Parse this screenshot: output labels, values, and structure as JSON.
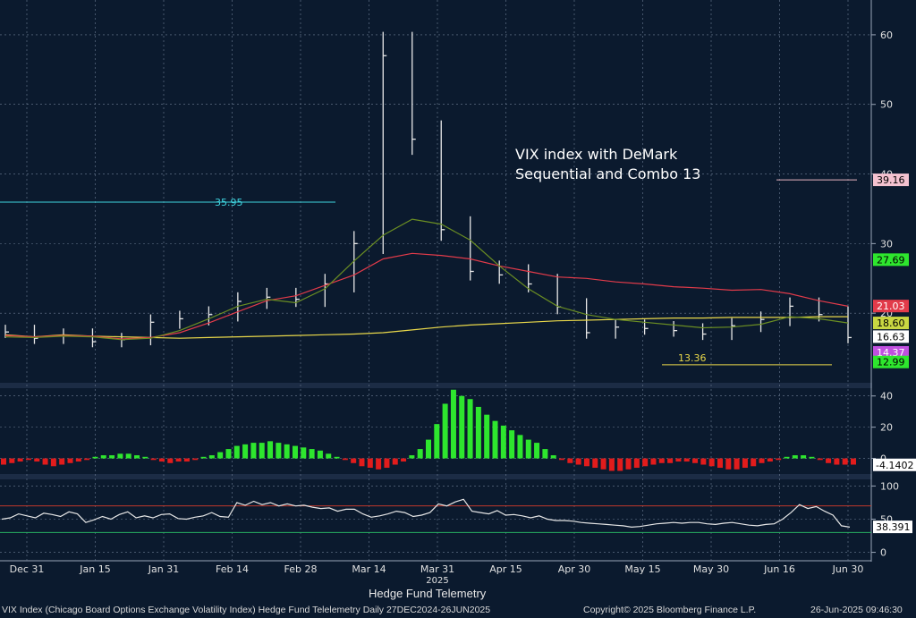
{
  "chart_data": [
    {
      "type": "bar",
      "panel": "price",
      "title": "VIX index with DeMark\nSequential and Combo 13",
      "ylim": [
        10,
        65
      ],
      "yticks": [
        20,
        30,
        40,
        50,
        60
      ],
      "grid": true,
      "x": [
        "Dec 31",
        "Jan 15",
        "Jan 31",
        "Feb 14",
        "Feb 28",
        "Mar 14",
        "Mar 31",
        "Apr 15",
        "Apr 30",
        "May 15",
        "May 30",
        "Jun 16",
        "Jun 30"
      ],
      "series": [
        {
          "values": [
            17.3,
            16.4,
            16.8,
            15.9,
            16.2,
            18.7,
            19.2,
            19.8,
            21.7,
            22.3,
            22.0,
            24.2,
            30.0,
            57.0,
            45.0,
            32.0,
            26.0,
            25.5,
            24.2,
            20.9,
            17.2,
            18.0,
            17.8,
            17.5,
            17.0,
            18.2,
            19.1,
            21.0,
            19.8,
            16.5
          ]
        },
        {
          "values": [
            16.9,
            16.6,
            16.9,
            16.7,
            16.6,
            16.5,
            16.4,
            16.5,
            16.6,
            16.7,
            16.8,
            16.9,
            17.0,
            17.2,
            17.6,
            18.0,
            18.3,
            18.5,
            18.7,
            18.9,
            19.0,
            19.1,
            19.2,
            19.3,
            19.3,
            19.4,
            19.4,
            19.4,
            19.5,
            19.5
          ]
        },
        {
          "values": [
            16.8,
            16.6,
            16.8,
            16.7,
            16.3,
            16.5,
            17.2,
            18.6,
            20.2,
            21.8,
            22.5,
            24.0,
            25.5,
            27.8,
            28.6,
            28.3,
            27.8,
            26.8,
            26.0,
            25.2,
            25.0,
            24.5,
            24.2,
            23.8,
            23.6,
            23.3,
            23.4,
            22.8,
            21.8,
            21.0
          ]
        },
        {
          "values": [
            16.6,
            16.5,
            16.7,
            16.6,
            16.2,
            16.4,
            17.5,
            19.2,
            21.0,
            22.0,
            21.5,
            23.5,
            27.5,
            31.2,
            33.5,
            32.8,
            30.5,
            26.8,
            23.5,
            21.0,
            19.8,
            19.1,
            18.7,
            18.3,
            17.9,
            18.0,
            18.4,
            19.5,
            19.2,
            18.6
          ]
        }
      ],
      "last_values": {
        "price_high": "39.16",
        "c1": "27.69",
        "c2": "21.03",
        "c3": "18.60",
        "close": "16.63",
        "c5": "14.37",
        "c6": "12.99"
      },
      "annotations": {
        "left_level": "35.95",
        "may_low": "13.36"
      }
    },
    {
      "type": "bar",
      "panel": "oscillator",
      "ylim": [
        -10,
        45
      ],
      "yticks": [
        0,
        20,
        40
      ],
      "grid": true,
      "last_value": "-4.1402",
      "values": [
        -4,
        -3,
        -2,
        -1,
        -2,
        -4,
        -5,
        -4,
        -3,
        -2,
        -1,
        1,
        2,
        2,
        3,
        3,
        2,
        1,
        -1,
        -2,
        -3,
        -2,
        -2,
        -1,
        1,
        2,
        4,
        6,
        8,
        9,
        10,
        10,
        11,
        10,
        9,
        8,
        7,
        6,
        5,
        3,
        1,
        -1,
        -3,
        -5,
        -6,
        -7,
        -6,
        -4,
        -2,
        2,
        6,
        12,
        22,
        35,
        44,
        40,
        38,
        33,
        28,
        24,
        21,
        18,
        15,
        12,
        10,
        6,
        2,
        -1,
        -3,
        -4,
        -5,
        -6,
        -7,
        -8,
        -8,
        -7,
        -6,
        -5,
        -4,
        -3,
        -3,
        -2,
        -2,
        -3,
        -4,
        -5,
        -6,
        -7,
        -7,
        -6,
        -5,
        -3,
        -2,
        -1,
        1,
        2,
        2,
        1,
        -1,
        -3,
        -4,
        -4,
        -4
      ]
    },
    {
      "type": "line",
      "panel": "breadth",
      "ylim": [
        -10,
        110
      ],
      "yticks": [
        0,
        50,
        100
      ],
      "grid": true,
      "last_value": "38.391",
      "values": [
        50,
        52,
        58,
        55,
        52,
        59,
        57,
        54,
        61,
        58,
        45,
        49,
        54,
        50,
        57,
        61,
        52,
        55,
        52,
        57,
        58,
        51,
        50,
        53,
        55,
        60,
        54,
        53,
        75,
        71,
        77,
        72,
        75,
        70,
        73,
        70,
        71,
        68,
        66,
        67,
        62,
        65,
        65,
        58,
        53,
        55,
        58,
        62,
        60,
        54,
        56,
        60,
        73,
        70,
        76,
        80,
        62,
        60,
        58,
        63,
        56,
        57,
        55,
        52,
        55,
        50,
        48,
        48,
        47,
        45,
        44,
        43,
        42,
        41,
        40,
        38,
        39,
        41,
        43,
        44,
        45,
        44,
        45,
        45,
        43,
        42,
        44,
        45,
        43,
        41,
        40,
        42,
        43,
        50,
        60,
        72,
        66,
        69,
        62,
        56,
        40,
        38
      ]
    },
    {
      "type": "axis",
      "tick_labels": [
        "Dec 31",
        "Jan 15",
        "Jan 31",
        "Feb 14",
        "Feb 28",
        "Mar 14",
        "Mar 31",
        "Apr 15",
        "Apr 30",
        "May 15",
        "May 30",
        "Jun 16",
        "Jun 30"
      ],
      "year_label": "2025"
    }
  ],
  "footer": {
    "title": "Hedge Fund Telemetry",
    "left": "VIX Index (Chicago Board Options Exchange Volatility Index) Hedge Fund Telelemetry  Daily 27DEC2024-26JUN2025",
    "copyright": "Copyright© 2025 Bloomberg Finance L.P.",
    "timestamp": "26-Jun-2025 09:46:30"
  },
  "colors": {
    "background": "#0b1a2e",
    "grid": "#6f7f95",
    "price_bars": "#e8e8e8",
    "sma_yellow": "#e9d84a",
    "sma_red": "#e23b4a",
    "sma_green": "#6b8e23",
    "osc_positive": "#2ee62e",
    "osc_negative": "#e21c1c",
    "breadth_line": "#e6e6e6",
    "upper_band": "#c0392b",
    "lower_band": "#27ae60"
  }
}
